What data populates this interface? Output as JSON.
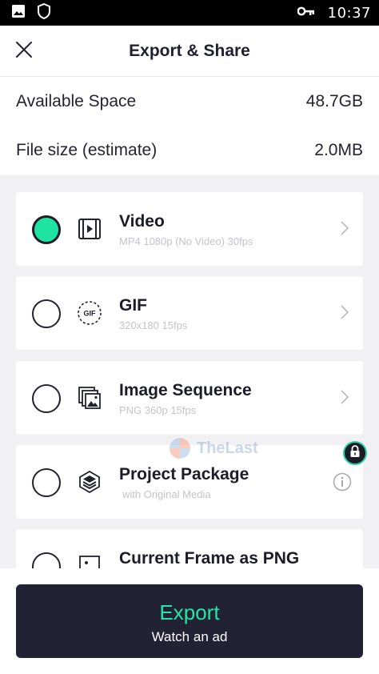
{
  "status_bar": {
    "time": "10:37",
    "icons": [
      "image-icon",
      "shield-icon",
      "key-icon"
    ]
  },
  "header": {
    "title": "Export & Share",
    "close_icon": "close-icon"
  },
  "info": {
    "available_space_label": "Available Space",
    "available_space_value": "48.7GB",
    "file_size_label": "File size (estimate)",
    "file_size_value": "2.0MB"
  },
  "options": [
    {
      "title": "Video",
      "subtitle": "MP4 1080p (No Video) 30fps",
      "selected": true,
      "icon": "video-icon",
      "action": "chevron-right-icon"
    },
    {
      "title": "GIF",
      "subtitle": "320x180 15fps",
      "selected": false,
      "icon": "gif-icon",
      "action": "chevron-right-icon"
    },
    {
      "title": "Image Sequence",
      "subtitle": "PNG 360p 15fps",
      "selected": false,
      "icon": "image-sequence-icon",
      "action": "chevron-right-icon"
    },
    {
      "title": "Project Package",
      "subtitle": "with Original Media",
      "selected": false,
      "icon": "layers-icon",
      "action": "info-icon",
      "locked": true
    },
    {
      "title": "Current Frame as PNG",
      "subtitle": "",
      "selected": false,
      "icon": "frame-icon"
    }
  ],
  "watermark": {
    "text": "TheLast"
  },
  "export": {
    "label": "Export",
    "sublabel": "Watch an ad"
  },
  "colors": {
    "accent": "#1fe3a1",
    "button_bg": "#222235",
    "options_bg": "#f1f1f3"
  }
}
